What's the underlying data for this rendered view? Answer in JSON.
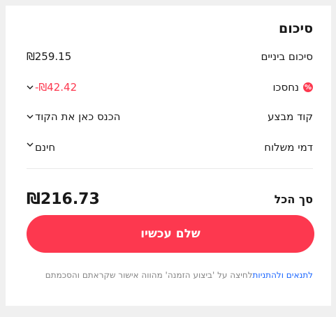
{
  "summary": {
    "title": "סיכום",
    "rows": {
      "subtotal": {
        "label": "סיכום ביניים",
        "value": "₪259.15"
      },
      "saved": {
        "label": "נחסכו",
        "value": "-₪42.42"
      },
      "promo": {
        "label": "קוד מבצע",
        "value": "הכנס כאן את הקוד"
      },
      "shipping": {
        "label": "דמי משלוח",
        "value": "חינם"
      }
    },
    "total": {
      "label": "סך הכל",
      "value": "₪216.73"
    },
    "pay_button": "שלם עכשיו",
    "legal": {
      "link": "לתנאים ולהתניות",
      "text": "לחיצה על 'ביצוע הזמנה' מהווה אישור שקראתם והסכמתם"
    }
  },
  "colors": {
    "accent": "#fd384f",
    "link": "#1a66ff",
    "muted": "#858585"
  }
}
